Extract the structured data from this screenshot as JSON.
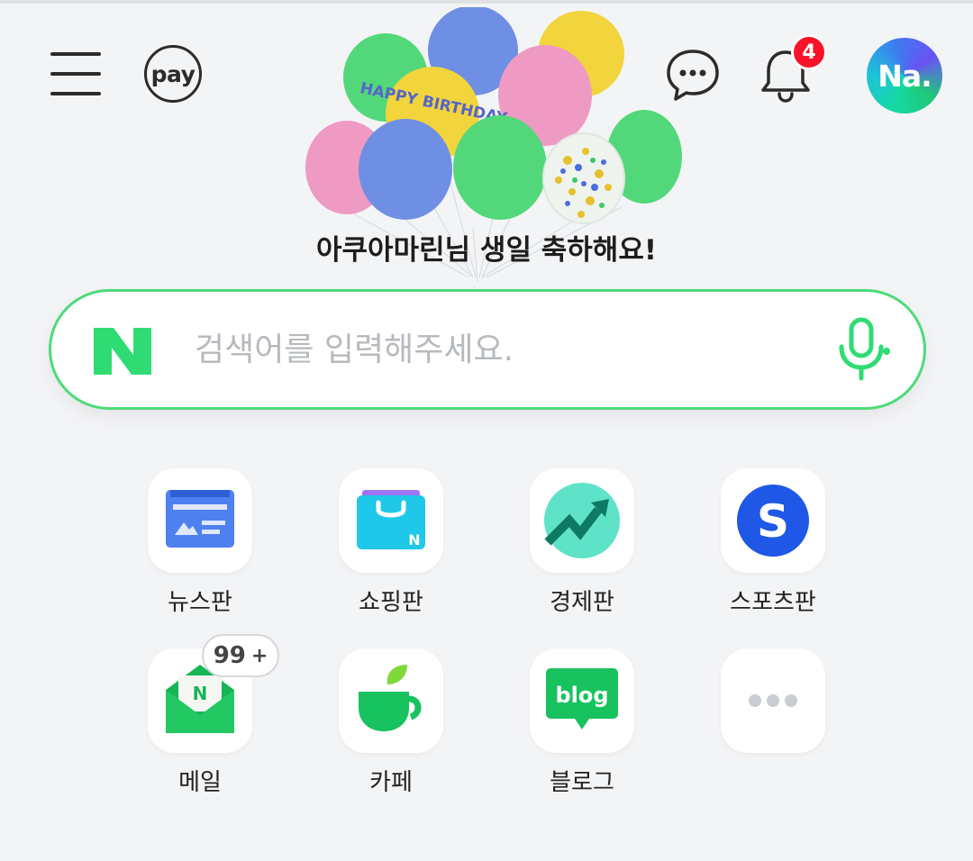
{
  "header": {
    "pay_label": "pay",
    "notification_count": "4",
    "avatar_text": "Na.",
    "balloon_text": "HAPPY BIRTHDAY"
  },
  "greeting": "아쿠아마린님 생일 축하해요!",
  "search": {
    "placeholder": "검색어를 입력해주세요.",
    "brand_color": "#03c75a",
    "border_color": "#4ddb79"
  },
  "apps": [
    {
      "label": "뉴스판",
      "icon": "news-icon"
    },
    {
      "label": "쇼핑판",
      "icon": "shopping-bag-icon"
    },
    {
      "label": "경제판",
      "icon": "stock-chart-icon"
    },
    {
      "label": "스포츠판",
      "icon": "sports-s-icon"
    },
    {
      "label": "메일",
      "icon": "mail-envelope-icon",
      "badge": "99",
      "badge_suffix": "+"
    },
    {
      "label": "카페",
      "icon": "cafe-cup-icon"
    },
    {
      "label": "블로그",
      "icon": "blog-bubble-icon",
      "icon_text": "blog"
    },
    {
      "label": "",
      "icon": "more-dots-icon"
    }
  ]
}
